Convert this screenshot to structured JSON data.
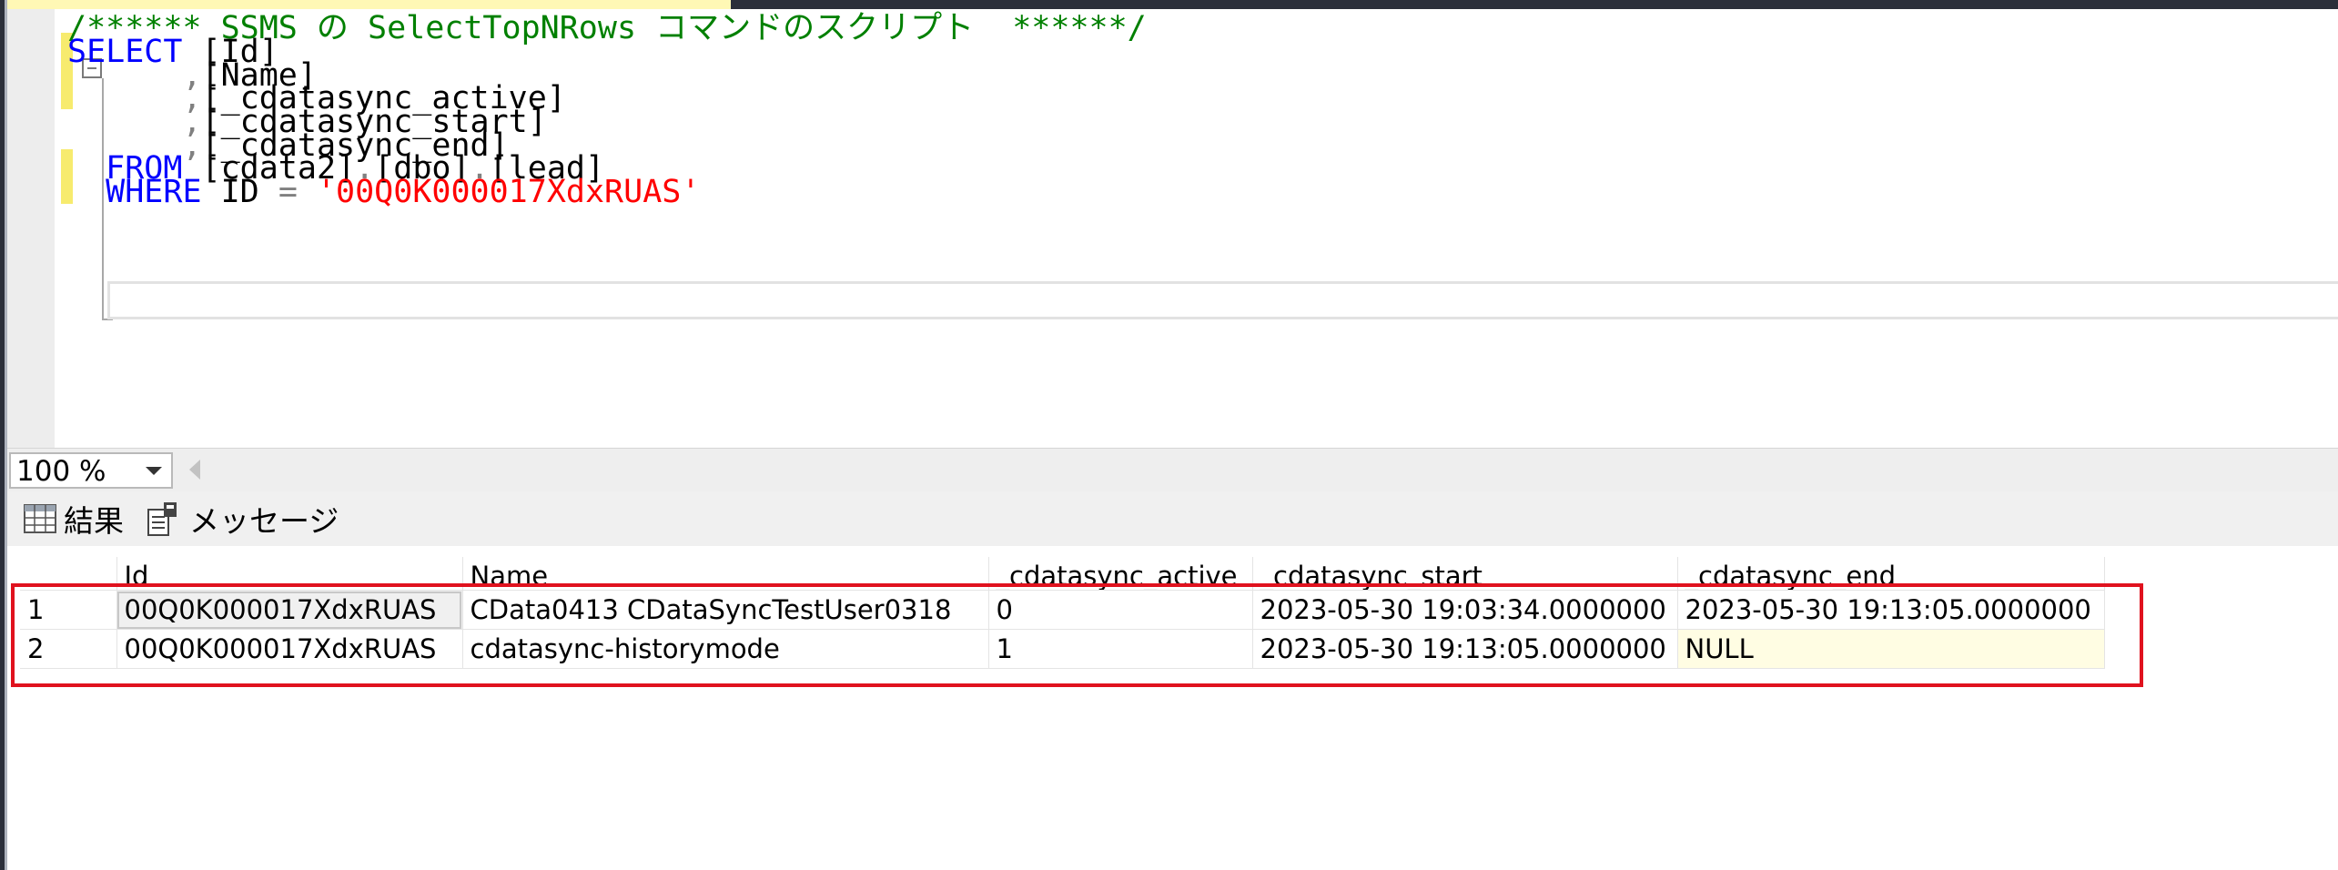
{
  "editor": {
    "lines": [
      {
        "indent": "",
        "tokens": [
          {
            "text": "/****** SSMS の SelectTopNRows コマンドのスクリプト  ******/",
            "cls": "cm"
          }
        ]
      },
      {
        "indent": "",
        "tokens": [
          {
            "text": "SELECT",
            "cls": "kw"
          },
          {
            "text": " [Id]",
            "cls": ""
          }
        ]
      },
      {
        "indent": "      ",
        "tokens": [
          {
            "text": ",",
            "cls": "pn"
          },
          {
            "text": "[Name]",
            "cls": ""
          }
        ]
      },
      {
        "indent": "      ",
        "tokens": [
          {
            "text": ",",
            "cls": "pn"
          },
          {
            "text": "[_cdatasync_active]",
            "cls": ""
          }
        ]
      },
      {
        "indent": "      ",
        "tokens": [
          {
            "text": ",",
            "cls": "pn"
          },
          {
            "text": "[_cdatasync_start]",
            "cls": ""
          }
        ]
      },
      {
        "indent": "      ",
        "tokens": [
          {
            "text": ",",
            "cls": "pn"
          },
          {
            "text": "[_cdatasync_end]",
            "cls": ""
          }
        ]
      },
      {
        "indent": "  ",
        "tokens": [
          {
            "text": "FROM",
            "cls": "kw"
          },
          {
            "text": " [cdata2]",
            "cls": ""
          },
          {
            "text": ".",
            "cls": "pn"
          },
          {
            "text": "[dbo]",
            "cls": ""
          },
          {
            "text": ".",
            "cls": "pn"
          },
          {
            "text": "[lead]",
            "cls": ""
          }
        ]
      },
      {
        "indent": "  ",
        "tokens": [
          {
            "text": "WHERE",
            "cls": "kw"
          },
          {
            "text": " ID ",
            "cls": ""
          },
          {
            "text": "=",
            "cls": "pn"
          },
          {
            "text": " ",
            "cls": ""
          },
          {
            "text": "'00Q0K000017XdxRUAS'",
            "cls": "st"
          }
        ]
      }
    ]
  },
  "zoom": {
    "value": "100 %"
  },
  "results_tabs": {
    "results_label": "結果",
    "messages_label": "メッセージ"
  },
  "grid": {
    "columns": [
      "",
      "Id",
      "Name",
      "_cdatasync_active",
      "_cdatasync_start",
      "_cdatasync_end"
    ],
    "rows": [
      [
        "1",
        "00Q0K000017XdxRUAS",
        "CData0413 CDataSyncTestUser0318",
        "0",
        "2023-05-30 19:03:34.0000000",
        "2023-05-30 19:13:05.0000000"
      ],
      [
        "2",
        "00Q0K000017XdxRUAS",
        "cdatasync-historymode",
        "1",
        "2023-05-30 19:13:05.0000000",
        "NULL"
      ]
    ]
  },
  "colors": {
    "keyword": "#0000ff",
    "comment": "#008000",
    "string": "#ff0000",
    "punctuation": "#808080",
    "highlight_box": "#e0121e",
    "change_marker": "#f7eb6e"
  }
}
